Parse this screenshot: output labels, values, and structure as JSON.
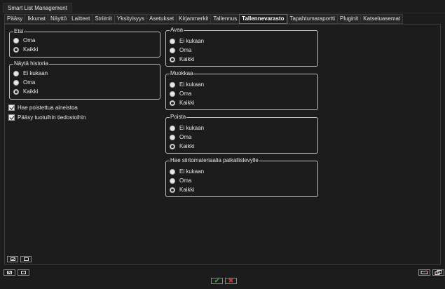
{
  "window": {
    "title": "Smart List Management"
  },
  "tabs": [
    "Pääsy",
    "Ikkunat",
    "Näyttö",
    "Laitteet",
    "Striimit",
    "Yksityisyys",
    "Asetukset",
    "Kirjanmerkit",
    "Tallennus",
    "Tallennevarasto",
    "Tapahtumaraportti",
    "Pluginit",
    "Katseluasemat"
  ],
  "active_tab": "Tallennevarasto",
  "groups": {
    "etsi": {
      "title": "Etsi",
      "options": [
        "Oma",
        "Kaikki"
      ],
      "selected": "Kaikki"
    },
    "nayta_historia": {
      "title": "Näytä historia",
      "options": [
        "Ei kukaan",
        "Oma",
        "Kaikki"
      ],
      "selected": "Kaikki"
    },
    "avaa": {
      "title": "Avaa",
      "options": [
        "Ei kukaan",
        "Oma",
        "Kaikki"
      ],
      "selected": "Kaikki"
    },
    "muokkaa": {
      "title": "Muokkaa",
      "options": [
        "Ei kukaan",
        "Oma",
        "Kaikki"
      ],
      "selected": "Kaikki"
    },
    "poista": {
      "title": "Poista",
      "options": [
        "Ei kukaan",
        "Oma",
        "Kaikki"
      ],
      "selected": "Kaikki"
    },
    "hae_siirto": {
      "title": "Hae siirtomateriaalia paikallislevylle",
      "options": [
        "Ei kukaan",
        "Oma",
        "Kaikki"
      ],
      "selected": "Kaikki"
    }
  },
  "checkboxes": [
    {
      "label": "Hae poistettua aineistoa",
      "checked": true
    },
    {
      "label": "Pääsy tuotuihin tiedostoihin",
      "checked": true
    }
  ],
  "colors": {
    "background": "#1c1c1c",
    "group_border": "#bdbdbd",
    "ok": "#3bbf3b",
    "cancel": "#e02f2f"
  },
  "icons": {
    "select_all": "checkbox-checked-icon",
    "deselect_all": "checkbox-empty-icon",
    "ok": "checkmark-icon",
    "cancel": "x-icon",
    "window_a": "window-icon",
    "window_b": "window-restore-icon"
  },
  "buttons": {
    "ok_glyph": "✔",
    "cancel_glyph": "✖"
  }
}
